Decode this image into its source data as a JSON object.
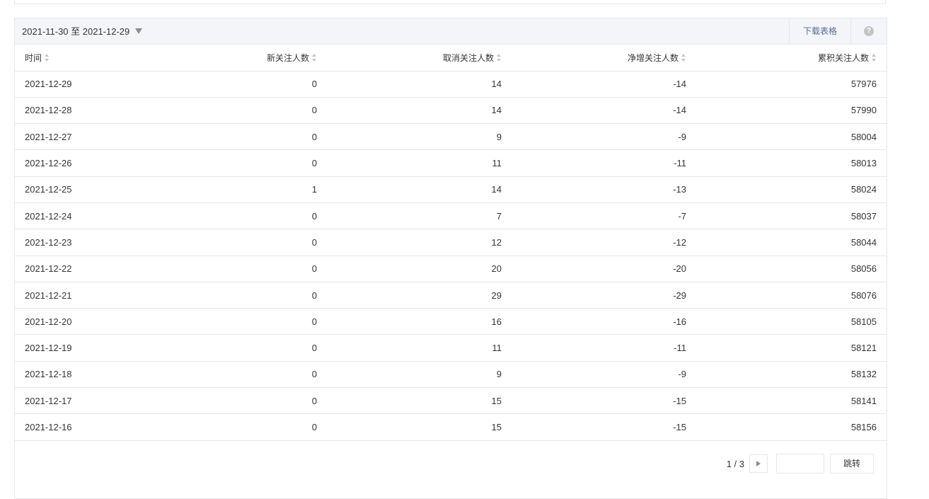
{
  "toolbar": {
    "date_range": "2021-11-30 至 2021-12-29",
    "download_label": "下载表格",
    "help_glyph": "?"
  },
  "table": {
    "columns": [
      "时间",
      "新关注人数",
      "取消关注人数",
      "净增关注人数",
      "累积关注人数"
    ],
    "rows": [
      [
        "2021-12-29",
        "0",
        "14",
        "-14",
        "57976"
      ],
      [
        "2021-12-28",
        "0",
        "14",
        "-14",
        "57990"
      ],
      [
        "2021-12-27",
        "0",
        "9",
        "-9",
        "58004"
      ],
      [
        "2021-12-26",
        "0",
        "11",
        "-11",
        "58013"
      ],
      [
        "2021-12-25",
        "1",
        "14",
        "-13",
        "58024"
      ],
      [
        "2021-12-24",
        "0",
        "7",
        "-7",
        "58037"
      ],
      [
        "2021-12-23",
        "0",
        "12",
        "-12",
        "58044"
      ],
      [
        "2021-12-22",
        "0",
        "20",
        "-20",
        "58056"
      ],
      [
        "2021-12-21",
        "0",
        "29",
        "-29",
        "58076"
      ],
      [
        "2021-12-20",
        "0",
        "16",
        "-16",
        "58105"
      ],
      [
        "2021-12-19",
        "0",
        "11",
        "-11",
        "58121"
      ],
      [
        "2021-12-18",
        "0",
        "9",
        "-9",
        "58132"
      ],
      [
        "2021-12-17",
        "0",
        "15",
        "-15",
        "58141"
      ],
      [
        "2021-12-16",
        "0",
        "15",
        "-15",
        "58156"
      ]
    ]
  },
  "pager": {
    "info": "1 / 3",
    "input_value": "",
    "jump_label": "跳转"
  },
  "icons": {
    "sort": "sort-icon",
    "dropdown": "caret-down-icon",
    "next": "chevron-right-icon",
    "help": "help-icon"
  },
  "colors": {
    "link": "#576b95",
    "toolbar_bg": "#f4f5f9",
    "border": "#e7e7eb"
  }
}
